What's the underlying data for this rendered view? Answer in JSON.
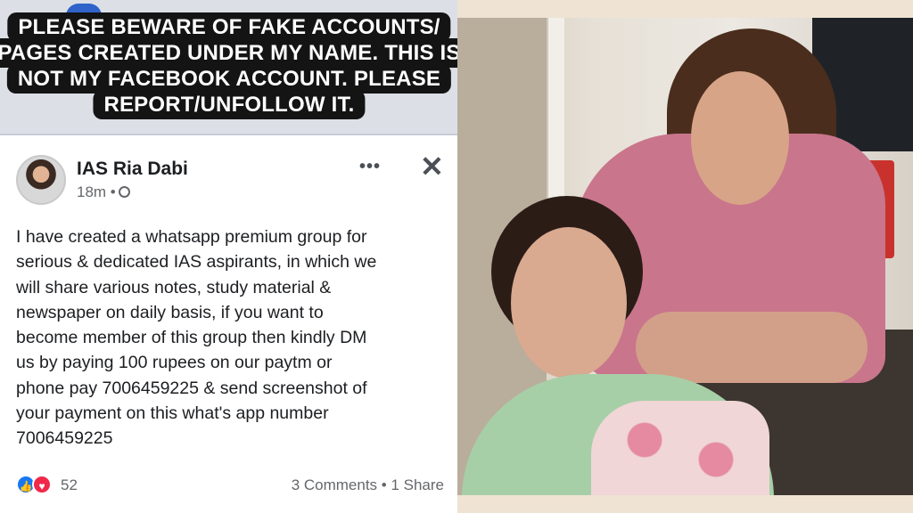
{
  "notice": {
    "lines": [
      "PLEASE BEWARE OF FAKE ACCOUNTS/",
      "PAGES CREATED UNDER MY NAME. THIS IS",
      "NOT MY FACEBOOK ACCOUNT. PLEASE",
      "REPORT/UNFOLLOW IT."
    ]
  },
  "post": {
    "author": "IAS Ria Dabi",
    "time": "18m •",
    "body_lines": [
      "I have created a whatsapp premium group for",
      "serious & dedicated IAS aspirants, in which we",
      "will share various notes, study material &",
      "newspaper on daily basis, if you want to",
      "become member of this group then kindly DM",
      "us by paying 100 rupees on our paytm or",
      "phone pay 7006459225 & send  screenshot of",
      "your payment on this what's app number",
      "7006459225"
    ],
    "reactions_count": "52",
    "comments_share": "3 Comments • 1 Share",
    "more_glyph": "•••",
    "close_glyph": "✕"
  },
  "icons": {
    "like": "thumbs-up-icon",
    "love": "heart-icon",
    "globe": "globe-icon"
  },
  "colors": {
    "like_blue": "#1877f2",
    "love_red": "#f02849",
    "notice_bg": "#141414",
    "page_bg": "#efe3d4"
  }
}
